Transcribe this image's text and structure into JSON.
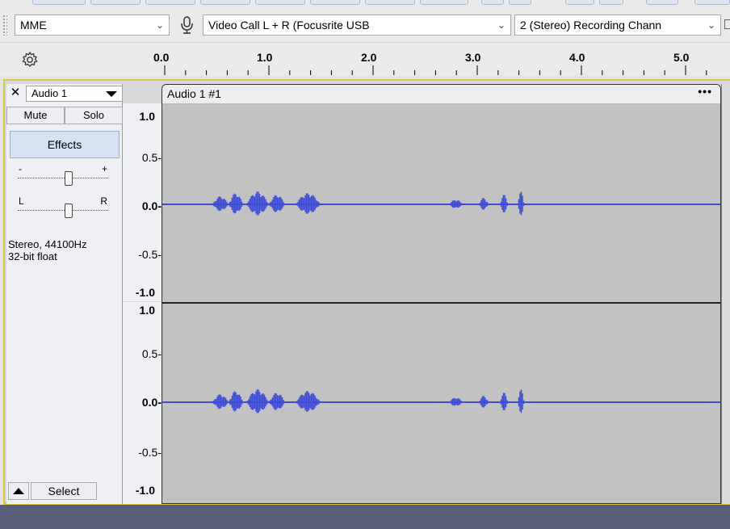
{
  "device_toolbar": {
    "host": "MME",
    "recording_device": "Video Call L + R (Focusrite USB",
    "recording_channels": "2 (Stereo) Recording Chann"
  },
  "ruler": {
    "labels": [
      "0.0",
      "1.0",
      "2.0",
      "3.0",
      "4.0",
      "5.0"
    ]
  },
  "track": {
    "name": "Audio 1",
    "mute_label": "Mute",
    "solo_label": "Solo",
    "effects_label": "Effects",
    "gain_minus": "-",
    "gain_plus": "+",
    "pan_left": "L",
    "pan_right": "R",
    "format_line1": "Stereo, 44100Hz",
    "format_line2": "32-bit float",
    "select_label": "Select"
  },
  "scale": {
    "top": [
      "1.0",
      "0.5-",
      "0.0-",
      "-0.5-",
      "-1.0"
    ],
    "bottom": [
      "1.0",
      "0.5-",
      "0.0-",
      "-0.5-",
      "-1.0"
    ]
  },
  "clip": {
    "title": "Audio 1 #1",
    "menu": "•••"
  },
  "colors": {
    "waveform": "#3f4cd6",
    "clip_bg": "#c2c2c2",
    "selection_border": "#d7c84c"
  }
}
